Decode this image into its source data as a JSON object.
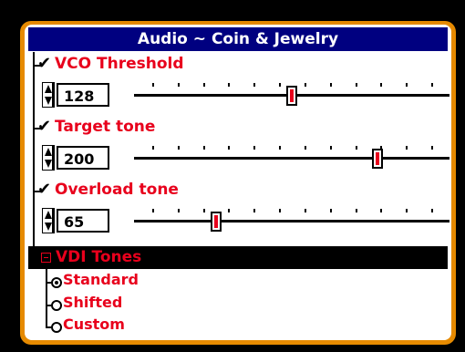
{
  "title": "Audio ~ Coin & Jewelry",
  "settings": [
    {
      "label": "VCO Threshold",
      "value": "128",
      "level_percent": 50
    },
    {
      "label": "Target tone",
      "value": "200",
      "level_percent": 78
    },
    {
      "label": "Overload tone",
      "value": "65",
      "level_percent": 25
    }
  ],
  "vdi": {
    "label": "VDI Tones",
    "options": [
      {
        "label": "Standard",
        "selected": true
      },
      {
        "label": "Shifted",
        "selected": false
      },
      {
        "label": "Custom",
        "selected": false
      }
    ]
  },
  "colors": {
    "frame": "#e68a00",
    "title_bar": "#000080",
    "label": "#e8001c",
    "thumb": "#e8001c"
  }
}
